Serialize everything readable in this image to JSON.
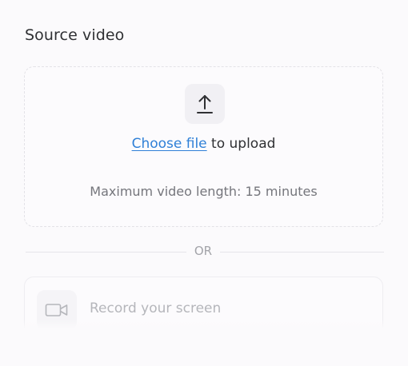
{
  "source_video": {
    "title": "Source video",
    "upload": {
      "icon": "upload-arrow-icon",
      "link_label": "Choose file",
      "suffix": " to upload",
      "limit_text": "Maximum video length: 15 minutes"
    },
    "divider_label": "OR",
    "record": {
      "icon": "video-camera-icon",
      "label": "Record your screen"
    }
  },
  "colors": {
    "link": "#2f80d7",
    "text": "#2f3033",
    "muted": "#75767c",
    "disabled": "#b5b6bb"
  }
}
